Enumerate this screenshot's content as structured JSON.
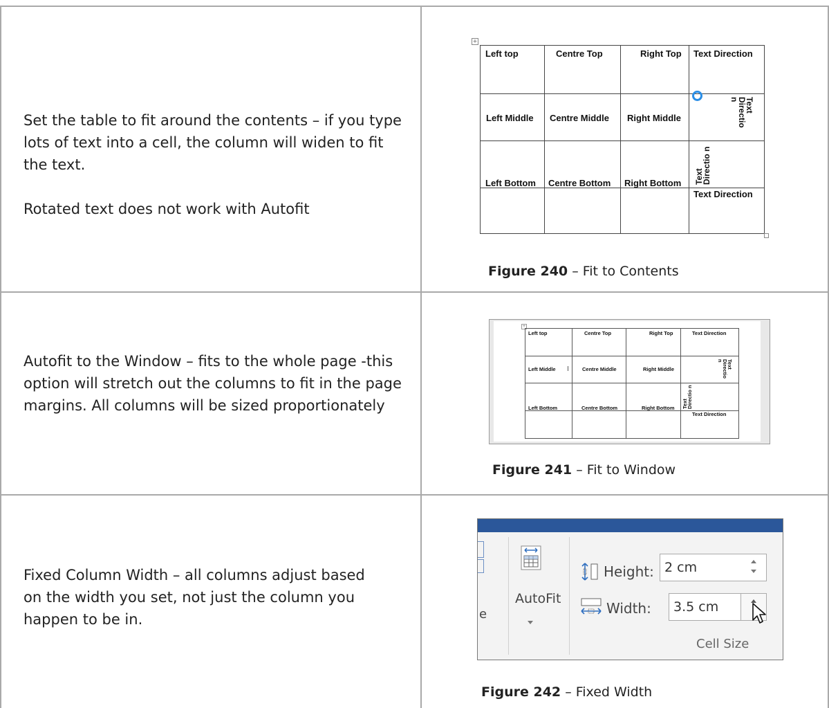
{
  "rows": [
    {
      "paragraphs": [
        "Set the table to fit around the contents – if you type lots of text into a cell, the column will widen to fit the text.",
        "Rotated text does not work with Autofit"
      ],
      "caption_label": "Figure 240",
      "caption_text": " – Fit to Contents"
    },
    {
      "paragraphs": [
        "Autofit to the Window – fits to the whole page -this option will stretch out the columns to fit in the page margins. All columns will be sized proportionately"
      ],
      "caption_label": "Figure 241",
      "caption_text": " – Fit to Window"
    },
    {
      "paragraphs": [
        "Fixed Column Width – all columns adjust based on the width you set, not just the column you happen to be in."
      ],
      "caption_label": "Figure 242",
      "caption_text": " – Fixed Width"
    }
  ],
  "sample_table": {
    "left_top": "Left top",
    "centre_top": "Centre Top",
    "right_top": "Right Top",
    "text_direction": "Text Direction",
    "left_middle": "Left Middle",
    "centre_middle": "Centre Middle",
    "right_middle": "Right Middle",
    "left_bottom": "Left Bottom",
    "centre_bottom": "Centre Bottom",
    "right_bottom": "Right Bottom"
  },
  "ribbon": {
    "autofit_label": "AutoFit",
    "height_label": "Height:",
    "height_value": "2 cm",
    "width_label": "Width:",
    "width_value": "3.5 cm",
    "group_label": "Cell Size"
  }
}
